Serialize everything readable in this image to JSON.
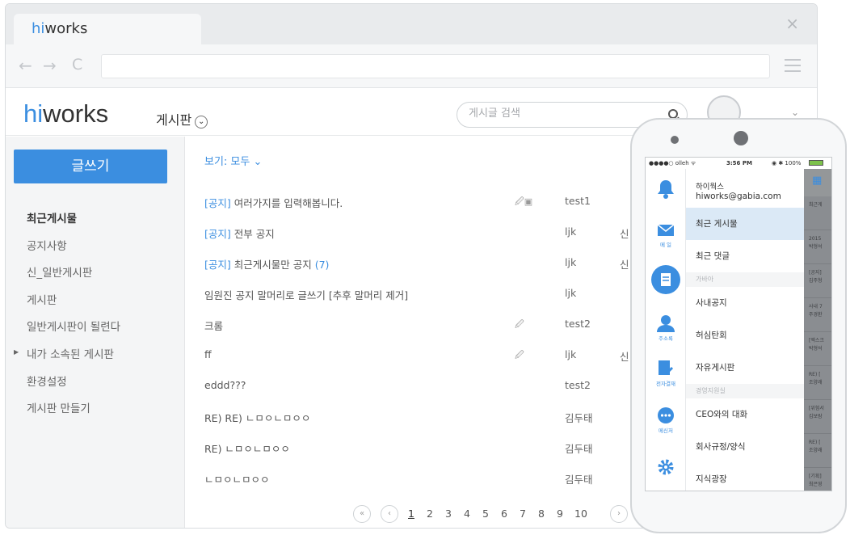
{
  "browser": {
    "tab_title": "hiworks",
    "close_glyph": "×",
    "back_glyph": "←",
    "forward_glyph": "→",
    "reload_glyph": "C"
  },
  "header": {
    "logo_hi": "hi",
    "logo_works": "works",
    "board_menu_label": "게시판",
    "search_placeholder": "게시글 검색"
  },
  "sidebar": {
    "write_label": "글쓰기",
    "items": [
      {
        "label": "최근게시물"
      },
      {
        "label": "공지사항"
      },
      {
        "label": "신_일반게시판"
      },
      {
        "label": "게시판"
      },
      {
        "label": "일반게시판이 될련다"
      },
      {
        "label": "내가 소속된 게시판"
      },
      {
        "label": "환경설정"
      },
      {
        "label": "게시판 만들기"
      }
    ]
  },
  "main": {
    "view_filter": "보기: 모두",
    "rows": [
      {
        "tag": "[공지]",
        "title": " 여러가지를 입력해봅니다.",
        "count": "",
        "att": "🖉▣",
        "author": "test1",
        "extra": ""
      },
      {
        "tag": "[공지]",
        "title": " 전부 공지",
        "count": "",
        "att": "",
        "author": "ljk",
        "extra": "신"
      },
      {
        "tag": "[공지]",
        "title": " 최근게시물만 공지 ",
        "count": "(7)",
        "att": "",
        "author": "ljk",
        "extra": "신"
      },
      {
        "tag": "",
        "title": "임원진 공지 말머리로 글쓰기 [추후 말머리 제거]",
        "count": "",
        "att": "",
        "author": "ljk",
        "extra": ""
      },
      {
        "tag": "",
        "title": "크롬",
        "count": "",
        "att": "🖉",
        "author": "test2",
        "extra": ""
      },
      {
        "tag": "",
        "title": "ff",
        "count": "",
        "att": "🖉",
        "author": "ljk",
        "extra": "신"
      },
      {
        "tag": "",
        "title": "eddd???",
        "count": "",
        "att": "",
        "author": "test2",
        "extra": ""
      },
      {
        "tag": "",
        "title": "RE) RE) ㄴㅁㅇㄴㅁㅇㅇ",
        "count": "",
        "att": "",
        "author": "김두태",
        "extra": ""
      },
      {
        "tag": "",
        "title": "RE) ㄴㅁㅇㄴㅁㅇㅇ",
        "count": "",
        "att": "",
        "author": "김두태",
        "extra": ""
      },
      {
        "tag": "",
        "title": "ㄴㅁㅇㄴㅁㅇㅇ",
        "count": "",
        "att": "",
        "author": "김두태",
        "extra": ""
      }
    ],
    "pager": {
      "first": "«",
      "prev": "‹",
      "next": "›",
      "pages": [
        "1",
        "2",
        "3",
        "4",
        "5",
        "6",
        "7",
        "8",
        "9",
        "10"
      ],
      "current": "1"
    }
  },
  "phone": {
    "status_carrier": "●●●●○ olleh ᯤ",
    "status_time": "3:56 PM",
    "status_right": "◉ ✱ 100%",
    "user_name": "하이웍스",
    "user_email": "hiworks@gabia.com",
    "rail_labels": [
      "메 일",
      "주소록",
      "전자결재",
      "메신저"
    ],
    "drawer_items": [
      {
        "label": "최근 게시물",
        "type": "item",
        "active": true
      },
      {
        "label": "최근 댓글",
        "type": "item",
        "active": false
      },
      {
        "label": "가바아",
        "type": "section"
      },
      {
        "label": "사내공지",
        "type": "item",
        "active": false
      },
      {
        "label": "허심탄회",
        "type": "item",
        "active": false
      },
      {
        "label": "자유게시판",
        "type": "item",
        "active": false
      },
      {
        "label": "경영지원실",
        "type": "section"
      },
      {
        "label": "CEO와의 대화",
        "type": "item",
        "active": false
      },
      {
        "label": "회사규정/양식",
        "type": "item",
        "active": false
      },
      {
        "label": "지식광장",
        "type": "item",
        "active": false
      }
    ],
    "sliver_cells": [
      "최근게",
      "2015\n박형석",
      "[공지]\n김주형",
      "사내 7\n주경환",
      "[엑스크\n박형석",
      "RE) [\n조양래",
      "[위험서\n김보람",
      "RE) [\n조양래",
      "[기획]\n최은영"
    ]
  },
  "colors": {
    "accent": "#3b8ee0",
    "sidebar_bg": "#f4f5f6"
  }
}
